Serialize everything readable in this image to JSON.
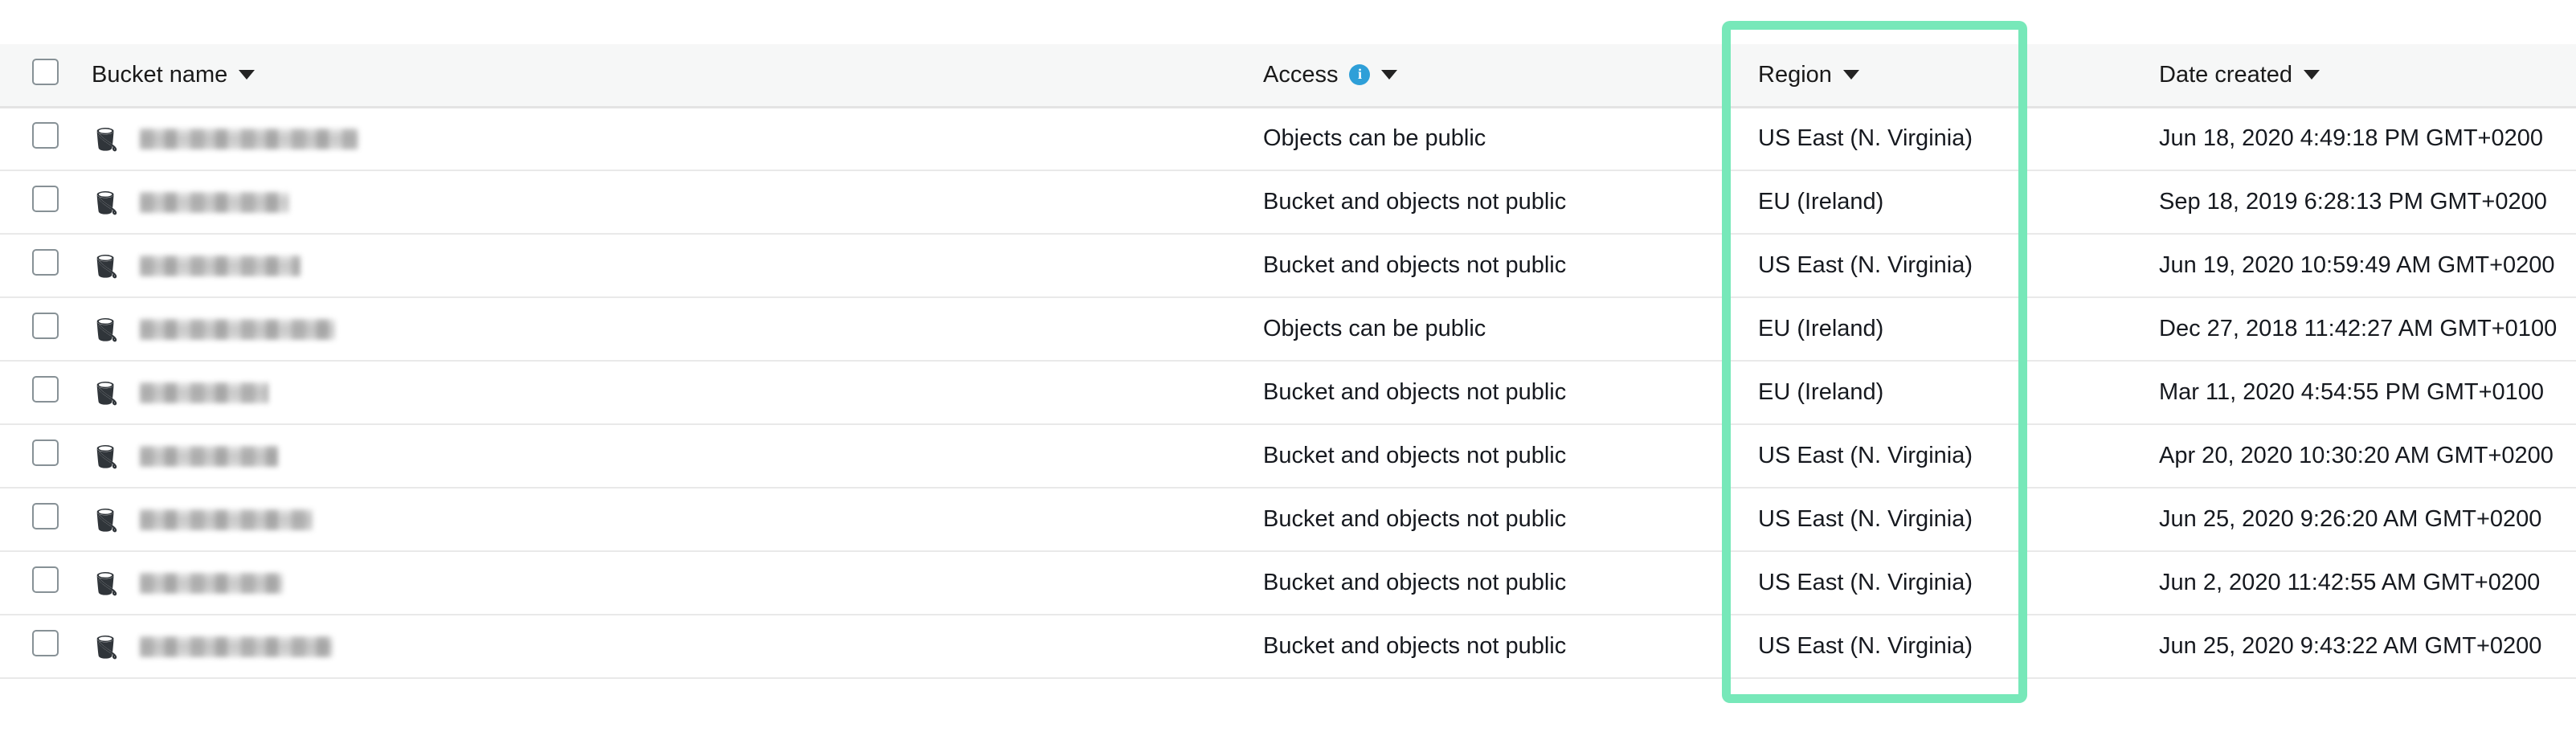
{
  "table": {
    "columns": [
      {
        "id": "select",
        "label": "",
        "sortable": false
      },
      {
        "id": "name",
        "label": "Bucket name",
        "sortable": true
      },
      {
        "id": "access",
        "label": "Access",
        "sortable": true,
        "has_info_icon": true
      },
      {
        "id": "region",
        "label": "Region",
        "sortable": true
      },
      {
        "id": "date",
        "label": "Date created",
        "sortable": true
      }
    ],
    "header": {
      "bucket_name": "Bucket name",
      "access": "Access",
      "region": "Region",
      "date_created": "Date created"
    },
    "rows": [
      {
        "name": "",
        "name_redacted": true,
        "name_width": 272,
        "access": "Objects can be public",
        "region": "US East (N. Virginia)",
        "date_created": "Jun 18, 2020 4:49:18 PM GMT+0200",
        "selected": false
      },
      {
        "name": "",
        "name_redacted": true,
        "name_width": 186,
        "access": "Bucket and objects not public",
        "region": "EU (Ireland)",
        "date_created": "Sep 18, 2019 6:28:13 PM GMT+0200",
        "selected": false
      },
      {
        "name": "",
        "name_redacted": true,
        "name_width": 200,
        "access": "Bucket and objects not public",
        "region": "US East (N. Virginia)",
        "date_created": "Jun 19, 2020 10:59:49 AM GMT+0200",
        "selected": false
      },
      {
        "name": "",
        "name_redacted": true,
        "name_width": 243,
        "access": "Objects can be public",
        "region": "EU (Ireland)",
        "date_created": "Dec 27, 2018 11:42:27 AM GMT+0100",
        "selected": false
      },
      {
        "name": "",
        "name_redacted": true,
        "name_width": 160,
        "access": "Bucket and objects not public",
        "region": "EU (Ireland)",
        "date_created": "Mar 11, 2020 4:54:55 PM GMT+0100",
        "selected": false
      },
      {
        "name": "",
        "name_redacted": true,
        "name_width": 172,
        "access": "Bucket and objects not public",
        "region": "US East (N. Virginia)",
        "date_created": "Apr 20, 2020 10:30:20 AM GMT+0200",
        "selected": false
      },
      {
        "name": "",
        "name_redacted": true,
        "name_width": 215,
        "access": "Bucket and objects not public",
        "region": "US East (N. Virginia)",
        "date_created": "Jun 25, 2020 9:26:20 AM GMT+0200",
        "selected": false
      },
      {
        "name": "",
        "name_redacted": true,
        "name_width": 178,
        "access": "Bucket and objects not public",
        "region": "US East (N. Virginia)",
        "date_created": "Jun 2, 2020 11:42:55 AM GMT+0200",
        "selected": false
      },
      {
        "name": "",
        "name_redacted": true,
        "name_width": 240,
        "access": "Bucket and objects not public",
        "region": "US East (N. Virginia)",
        "date_created": "Jun 25, 2020 9:43:22 AM GMT+0200",
        "selected": false
      }
    ]
  },
  "annotation": {
    "type": "highlight-rectangle",
    "target_column": "Region",
    "color": "#77e8b9"
  },
  "icons": {
    "sort_caret": "caret-down-icon",
    "info": "info-icon",
    "bucket": "s3-bucket-icon"
  },
  "colors": {
    "header_background": "#f6f7f7",
    "row_background": "#ffffff",
    "row_divider": "#e9e9e9",
    "text": "#16191f",
    "info_icon": "#2e9fd8",
    "highlight": "#77e8b9"
  }
}
